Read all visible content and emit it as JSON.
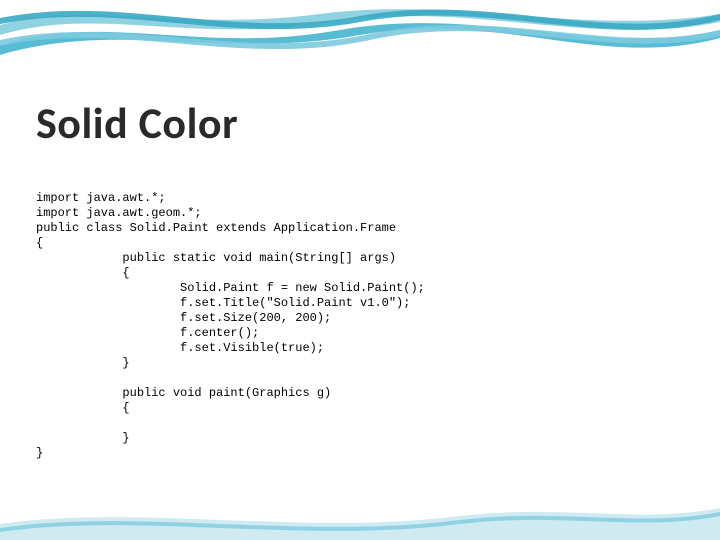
{
  "title": "Solid Color",
  "code": {
    "l01": "import java.awt.*;",
    "l02": "import java.awt.geom.*;",
    "l03": "public class Solid.Paint extends Application.Frame",
    "l04": "{",
    "l05": "            public static void main(String[] args)",
    "l06": "            {",
    "l07": "                    Solid.Paint f = new Solid.Paint();",
    "l08": "                    f.set.Title(\"Solid.Paint v1.0\");",
    "l09": "                    f.set.Size(200, 200);",
    "l10": "                    f.center();",
    "l11": "                    f.set.Visible(true);",
    "l12": "            }",
    "l13": "",
    "l14": "            public void paint(Graphics g)",
    "l15": "            {",
    "l16": "",
    "l17": "            }",
    "l18": "}"
  }
}
